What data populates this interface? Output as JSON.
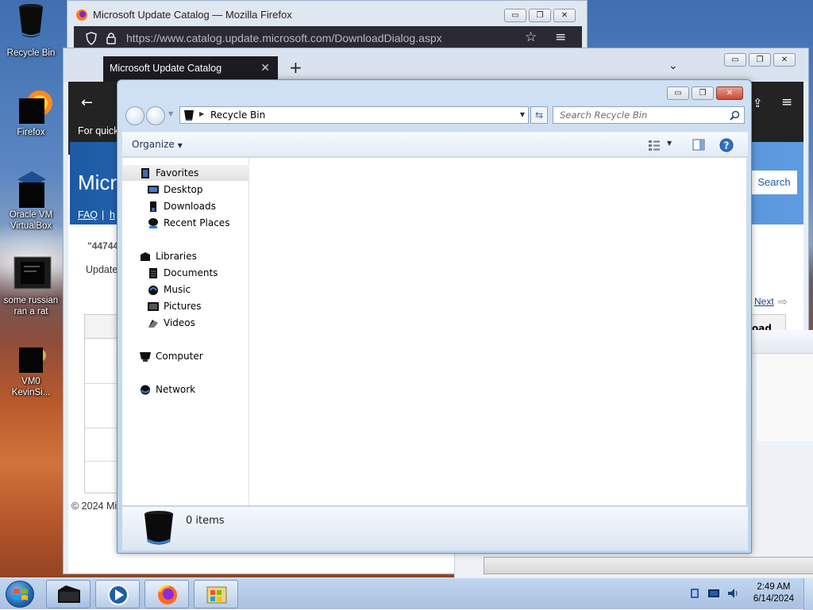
{
  "desktop": {
    "icons": [
      {
        "label": "Recycle Bin"
      },
      {
        "label": "Firefox"
      },
      {
        "label": "Oracle VM VirtualBox"
      },
      {
        "label": "some russian ran a rat"
      },
      {
        "label": "VM0 KevinSi..."
      }
    ]
  },
  "firefox_back": {
    "title": "Microsoft Update Catalog — Mozilla Firefox",
    "url": "https://www.catalog.update.microsoft.com/DownloadDialog.aspx"
  },
  "firefox_main": {
    "tab_label": "Microsoft Update Catalog",
    "new_tab": "+",
    "page": {
      "for_quick": "For quick",
      "banner_title": "Micr",
      "faq": "FAQ",
      "pipe": "|",
      "frag_h": "h",
      "search_button": "Search",
      "query_frag": "\"44744",
      "updates_frag": "Updates",
      "next": "Next",
      "col_download_frag": "oad",
      "footer": "© 2024 Mic"
    }
  },
  "explorer": {
    "address": "Recycle Bin",
    "search_placeholder": "Search Recycle Bin",
    "organize": "Organize",
    "nav": {
      "favorites": "Favorites",
      "desktop": "Desktop",
      "downloads": "Downloads",
      "recent_places": "Recent Places",
      "libraries": "Libraries",
      "documents": "Documents",
      "music": "Music",
      "pictures": "Pictures",
      "videos": "Videos",
      "computer": "Computer",
      "network": "Network"
    },
    "status": "0 items"
  },
  "taskbar": {
    "time": "2:49 AM",
    "date": "6/14/2024"
  },
  "colors": {
    "accent": "#1a58b5",
    "close_red": "#c74a36"
  }
}
